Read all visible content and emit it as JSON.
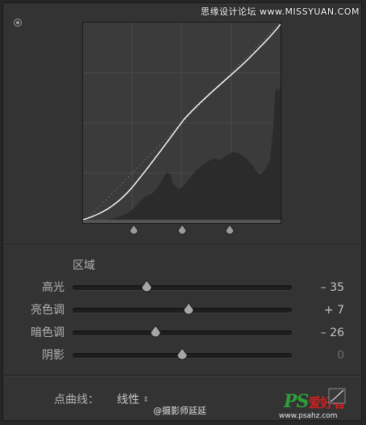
{
  "watermark_top": "思缘设计论坛 www.MISSYUAN.COM",
  "curve_panel": {
    "histogram_color": "#2a2a2a",
    "curve_color": "#ffffff"
  },
  "region": {
    "title": "区域",
    "sliders": [
      {
        "label": "高光",
        "value": "– 35",
        "position": 0.34,
        "dim": false
      },
      {
        "label": "亮色调",
        "value": "+ 7",
        "position": 0.53,
        "dim": false
      },
      {
        "label": "暗色调",
        "value": "– 26",
        "position": 0.38,
        "dim": false
      },
      {
        "label": "阴影",
        "value": "0",
        "position": 0.5,
        "dim": true
      }
    ]
  },
  "point_curve": {
    "label": "点曲线：",
    "value": "线性",
    "arrow": "⇕"
  },
  "author": "@摄影师延延",
  "logo": {
    "ps": "PS",
    "cn": "爱好者",
    "url": "www.psahz.com"
  }
}
